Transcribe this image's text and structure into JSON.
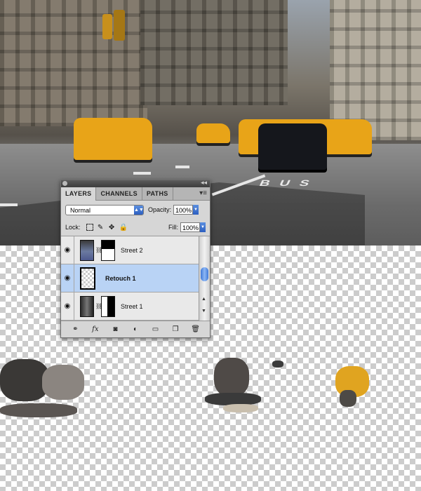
{
  "panel": {
    "tabs": [
      "LAYERS",
      "CHANNELS",
      "PATHS"
    ],
    "collapse_icon": "collapse-icon",
    "blend_mode": "Normal",
    "opacity_label": "Opacity:",
    "opacity_value": "100%",
    "lock_label": "Lock:",
    "fill_label": "Fill:",
    "fill_value": "100%",
    "layers": [
      {
        "name": "Street 2",
        "selected": false
      },
      {
        "name": "Retouch 1",
        "selected": true
      },
      {
        "name": "Street 1",
        "selected": false
      }
    ],
    "footer_icons": [
      "link-layers-icon",
      "fx-icon",
      "add-mask-icon",
      "adjustment-layer-icon",
      "new-group-icon",
      "new-layer-icon",
      "trash-icon"
    ],
    "footer_fx": "fx"
  },
  "canvas": {
    "road_text": "BUS"
  },
  "colors": {
    "selection": "#b9d3f5",
    "accent": "#2c5fc0",
    "taxi": "#e8a418"
  }
}
